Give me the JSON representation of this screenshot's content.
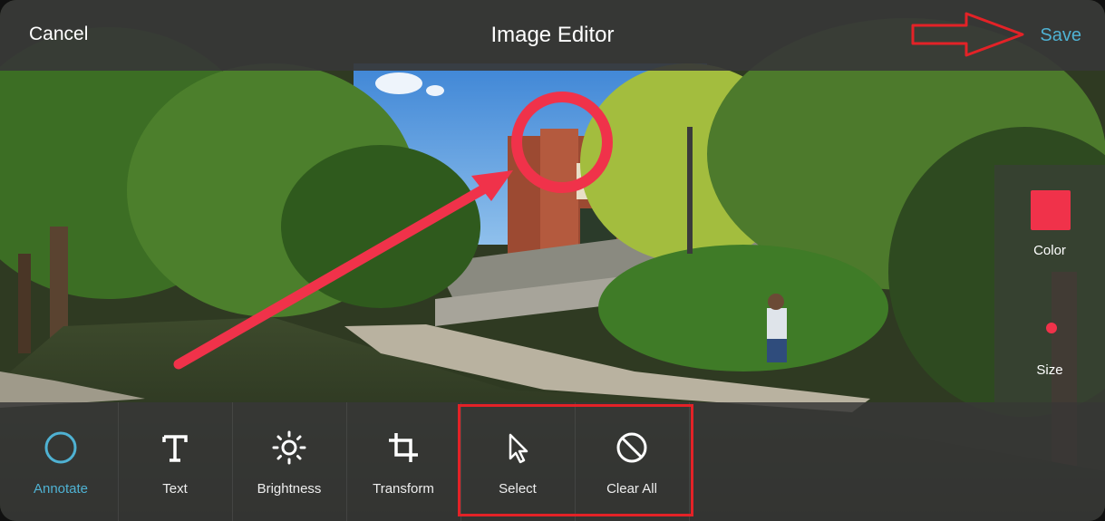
{
  "header": {
    "cancel_label": "Cancel",
    "title": "Image Editor",
    "save_label": "Save"
  },
  "side_panel": {
    "color_label": "Color",
    "size_label": "Size"
  },
  "toolbar": {
    "tools": [
      {
        "label": "Annotate",
        "icon": "circle-icon",
        "active": true
      },
      {
        "label": "Text",
        "icon": "text-icon",
        "active": false
      },
      {
        "label": "Brightness",
        "icon": "brightness-icon",
        "active": false
      },
      {
        "label": "Transform",
        "icon": "crop-icon",
        "active": false
      },
      {
        "label": "Select",
        "icon": "cursor-icon",
        "active": false
      },
      {
        "label": "Clear All",
        "icon": "clear-all-icon",
        "active": false
      }
    ]
  },
  "colors": {
    "accent": "#4fb2d3",
    "annotation": "#f0324a",
    "callout": "#e32227"
  }
}
